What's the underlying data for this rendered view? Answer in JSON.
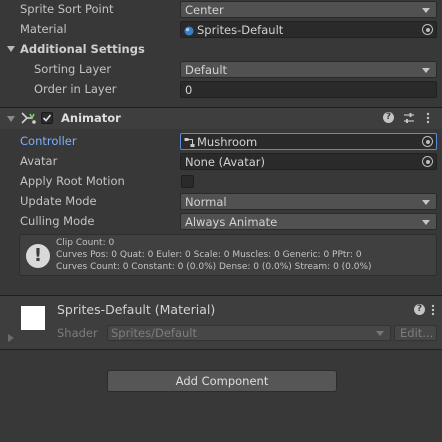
{
  "renderer": {
    "sprite_sort_point_label": "Sprite Sort Point",
    "sprite_sort_point_value": "Center",
    "material_label": "Material",
    "material_value": "Sprites-Default",
    "additional_settings_label": "Additional Settings",
    "sorting_layer_label": "Sorting Layer",
    "sorting_layer_value": "Default",
    "order_in_layer_label": "Order in Layer",
    "order_in_layer_value": "0"
  },
  "animator": {
    "title": "Animator",
    "enabled": true,
    "controller_label": "Controller",
    "controller_value": "Mushroom",
    "avatar_label": "Avatar",
    "avatar_value": "None (Avatar)",
    "apply_root_motion_label": "Apply Root Motion",
    "apply_root_motion": false,
    "update_mode_label": "Update Mode",
    "update_mode_value": "Normal",
    "culling_mode_label": "Culling Mode",
    "culling_mode_value": "Always Animate",
    "info_line1": "Clip Count: 0",
    "info_line2": "Curves Pos: 0 Quat: 0 Euler: 0 Scale: 0 Muscles: 0 Generic: 0 PPtr: 0",
    "info_line3": "Curves Count: 0 Constant: 0 (0.0%) Dense: 0 (0.0%) Stream: 0 (0.0%)"
  },
  "material_section": {
    "title": "Sprites-Default (Material)",
    "shader_label": "Shader",
    "shader_value": "Sprites/Default",
    "edit_label": "Edit..."
  },
  "add_component_label": "Add Component",
  "colors": {
    "background": "#383838",
    "field": "#2a2a2a",
    "dropdown": "#515151",
    "accent_blue": "#7cb0ff"
  }
}
